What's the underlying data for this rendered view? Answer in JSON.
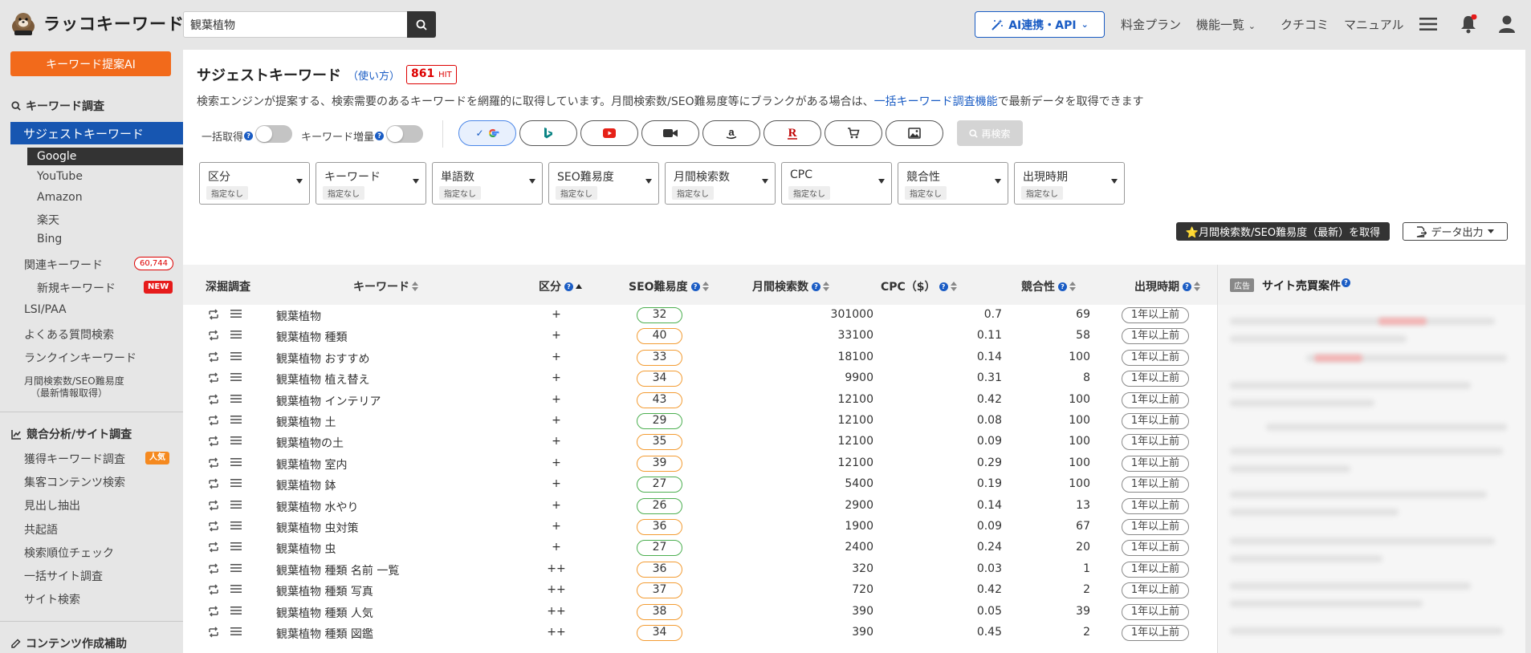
{
  "header": {
    "logo_text": "ラッコキーワード",
    "search_value": "観葉植物",
    "ai_button_label": "AI連携・API",
    "nav": {
      "pricing": "料金プラン",
      "features": "機能一覧",
      "reviews": "クチコミ",
      "manual": "マニュアル"
    }
  },
  "sidebar": {
    "kw_ai_button": "キーワード提案AI",
    "section_keyword": "キーワード調査",
    "suggest": "サジェストキーワード",
    "sub": [
      "Google",
      "YouTube",
      "Amazon",
      "楽天",
      "Bing"
    ],
    "related": "関連キーワード",
    "related_count": "60,744",
    "new_keyword": "新規キーワード",
    "new_badge": "NEW",
    "lsi": "LSI/PAA",
    "faq": "よくある質問検索",
    "rankin": "ランクインキーワード",
    "monthly_line1": "月間検索数/SEO難易度",
    "monthly_line2": "（最新情報取得）",
    "section_competitor": "競合分析/サイト調査",
    "acquired": "獲得キーワード調査",
    "popular_badge": "人気",
    "content_search": "集客コンテンツ検索",
    "headings": "見出し抽出",
    "cooccur": "共起語",
    "rank_check": "検索順位チェック",
    "bulk_site": "一括サイト調査",
    "site_search": "サイト検索",
    "section_content": "コンテンツ作成補助"
  },
  "main": {
    "title": "サジェストキーワード",
    "howto": "（使い方）",
    "hit_count": "861",
    "hit_unit": "HIT",
    "desc_before": "検索エンジンが提案する、検索需要のあるキーワードを網羅的に取得しています。月間検索数/SEO難易度等にブランクがある場合は、",
    "desc_link": "一括キーワード調査機能",
    "desc_after": "で最新データを取得できます",
    "toggle_bulk": "一括取得",
    "toggle_expand": "キーワード増量",
    "research": "再検索",
    "filters": [
      {
        "label": "区分",
        "value": "指定なし"
      },
      {
        "label": "キーワード",
        "value": "指定なし"
      },
      {
        "label": "単語数",
        "value": "指定なし"
      },
      {
        "label": "SEO難易度",
        "value": "指定なし"
      },
      {
        "label": "月間検索数",
        "value": "指定なし"
      },
      {
        "label": "CPC",
        "value": "指定なし"
      },
      {
        "label": "競合性",
        "value": "指定なし"
      },
      {
        "label": "出現時期",
        "value": "指定なし"
      }
    ],
    "fetch_button": "⭐月間検索数/SEO難易度（最新）を取得",
    "export_button": "データ出力"
  },
  "table": {
    "headers": {
      "deep": "深掘調査",
      "keyword": "キーワード",
      "category": "区分",
      "seo": "SEO難易度",
      "volume": "月間検索数",
      "cpc": "CPC（$）",
      "competition": "競合性",
      "period": "出現時期"
    },
    "rows": [
      {
        "keyword": "観葉植物",
        "category": "+",
        "seo": "32",
        "seo_level": "green",
        "volume": "301000",
        "cpc": "0.7",
        "competition": "69",
        "period": "1年以上前"
      },
      {
        "keyword": "観葉植物 種類",
        "category": "+",
        "seo": "40",
        "seo_level": "orange",
        "volume": "33100",
        "cpc": "0.11",
        "competition": "58",
        "period": "1年以上前"
      },
      {
        "keyword": "観葉植物 おすすめ",
        "category": "+",
        "seo": "33",
        "seo_level": "orange",
        "volume": "18100",
        "cpc": "0.14",
        "competition": "100",
        "period": "1年以上前"
      },
      {
        "keyword": "観葉植物 植え替え",
        "category": "+",
        "seo": "34",
        "seo_level": "orange",
        "volume": "9900",
        "cpc": "0.31",
        "competition": "8",
        "period": "1年以上前"
      },
      {
        "keyword": "観葉植物 インテリア",
        "category": "+",
        "seo": "43",
        "seo_level": "orange",
        "volume": "12100",
        "cpc": "0.42",
        "competition": "100",
        "period": "1年以上前"
      },
      {
        "keyword": "観葉植物 土",
        "category": "+",
        "seo": "29",
        "seo_level": "green",
        "volume": "12100",
        "cpc": "0.08",
        "competition": "100",
        "period": "1年以上前"
      },
      {
        "keyword": "観葉植物の土",
        "category": "+",
        "seo": "35",
        "seo_level": "orange",
        "volume": "12100",
        "cpc": "0.09",
        "competition": "100",
        "period": "1年以上前"
      },
      {
        "keyword": "観葉植物 室内",
        "category": "+",
        "seo": "39",
        "seo_level": "orange",
        "volume": "12100",
        "cpc": "0.29",
        "competition": "100",
        "period": "1年以上前"
      },
      {
        "keyword": "観葉植物 鉢",
        "category": "+",
        "seo": "27",
        "seo_level": "green",
        "volume": "5400",
        "cpc": "0.19",
        "competition": "100",
        "period": "1年以上前"
      },
      {
        "keyword": "観葉植物 水やり",
        "category": "+",
        "seo": "26",
        "seo_level": "green",
        "volume": "2900",
        "cpc": "0.14",
        "competition": "13",
        "period": "1年以上前"
      },
      {
        "keyword": "観葉植物 虫対策",
        "category": "+",
        "seo": "36",
        "seo_level": "orange",
        "volume": "1900",
        "cpc": "0.09",
        "competition": "67",
        "period": "1年以上前"
      },
      {
        "keyword": "観葉植物 虫",
        "category": "+",
        "seo": "27",
        "seo_level": "green",
        "volume": "2400",
        "cpc": "0.24",
        "competition": "20",
        "period": "1年以上前"
      },
      {
        "keyword": "観葉植物 種類 名前 一覧",
        "category": "++",
        "seo": "36",
        "seo_level": "orange",
        "volume": "320",
        "cpc": "0.03",
        "competition": "1",
        "period": "1年以上前"
      },
      {
        "keyword": "観葉植物 種類 写真",
        "category": "++",
        "seo": "37",
        "seo_level": "orange",
        "volume": "720",
        "cpc": "0.42",
        "competition": "2",
        "period": "1年以上前"
      },
      {
        "keyword": "観葉植物 種類 人気",
        "category": "++",
        "seo": "38",
        "seo_level": "orange",
        "volume": "390",
        "cpc": "0.05",
        "competition": "39",
        "period": "1年以上前"
      },
      {
        "keyword": "観葉植物 種類 図鑑",
        "category": "++",
        "seo": "34",
        "seo_level": "orange",
        "volume": "390",
        "cpc": "0.45",
        "competition": "2",
        "period": "1年以上前"
      }
    ]
  },
  "ad": {
    "tag": "広告",
    "title": "サイト売買案件"
  },
  "colors": {
    "accent_orange": "#f26a1b",
    "active_blue": "#1756b1",
    "link_blue": "#1a5cc4",
    "seo_green": "#4caf50",
    "seo_orange": "#f39c33"
  }
}
